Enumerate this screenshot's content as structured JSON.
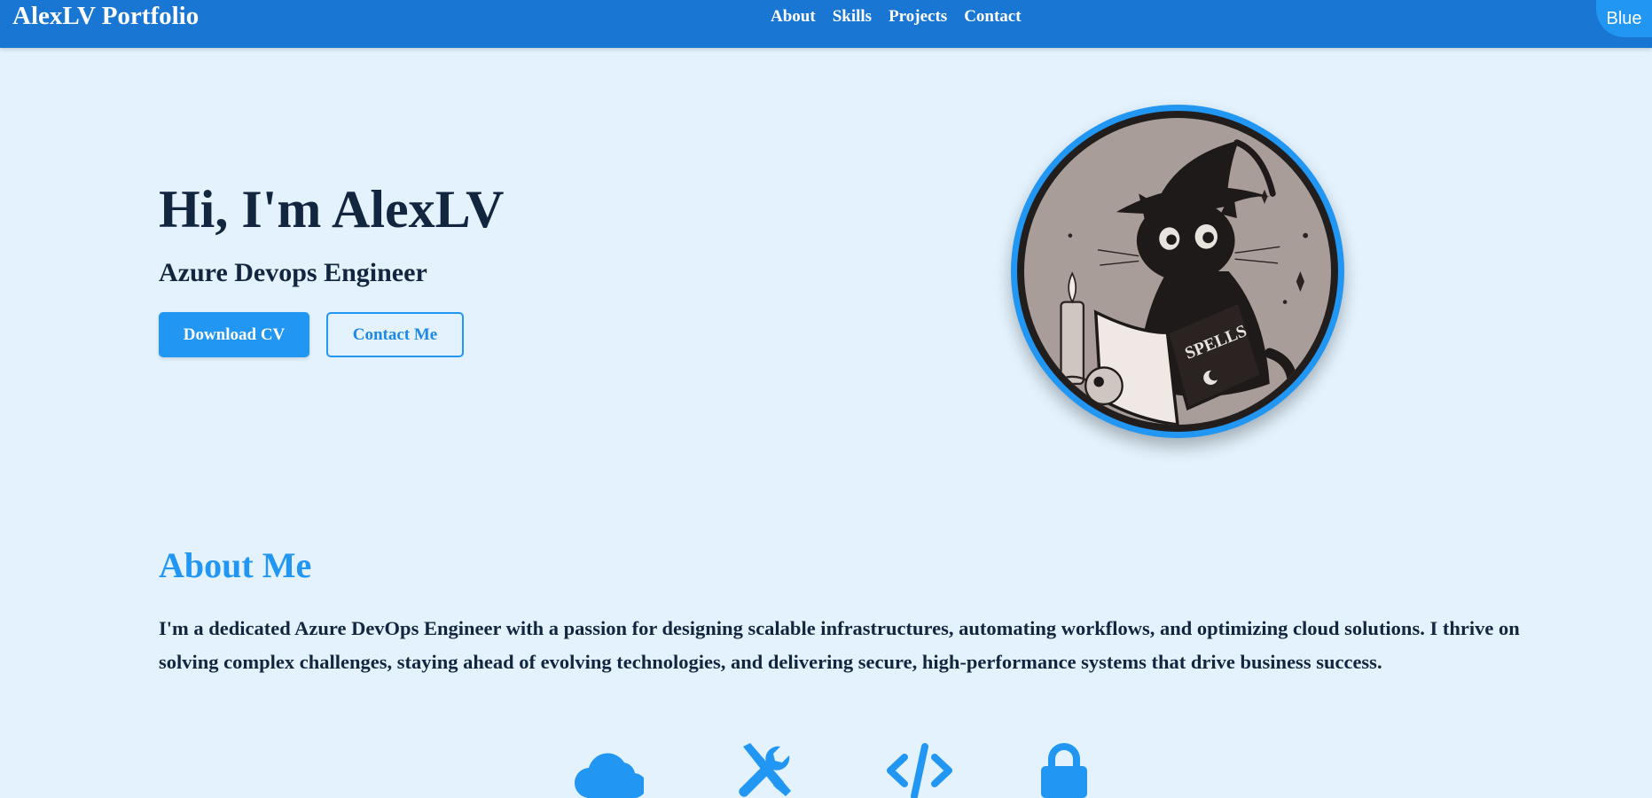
{
  "navbar": {
    "brand": "AlexLV Portfolio",
    "links": [
      "About",
      "Skills",
      "Projects",
      "Contact"
    ],
    "theme_toggle": "Blue"
  },
  "hero": {
    "title": "Hi, I'm AlexLV",
    "subtitle": "Azure Devops Engineer",
    "primary_button": "Download CV",
    "secondary_button": "Contact Me",
    "avatar_book_text": "SPELLS"
  },
  "about": {
    "heading": "About Me",
    "text": "I'm a dedicated Azure DevOps Engineer with a passion for designing scalable infrastructures, automating workflows, and optimizing cloud solutions. I thrive on solving complex challenges, staying ahead of evolving technologies, and delivering secure, high-performance systems that drive business success.",
    "icons": [
      "cloud-icon",
      "tools-icon",
      "code-icon",
      "lock-icon"
    ]
  },
  "colors": {
    "background": "#e3f2fd",
    "navbar": "#1976d2",
    "accent": "#2196f3",
    "text": "#13263f"
  }
}
